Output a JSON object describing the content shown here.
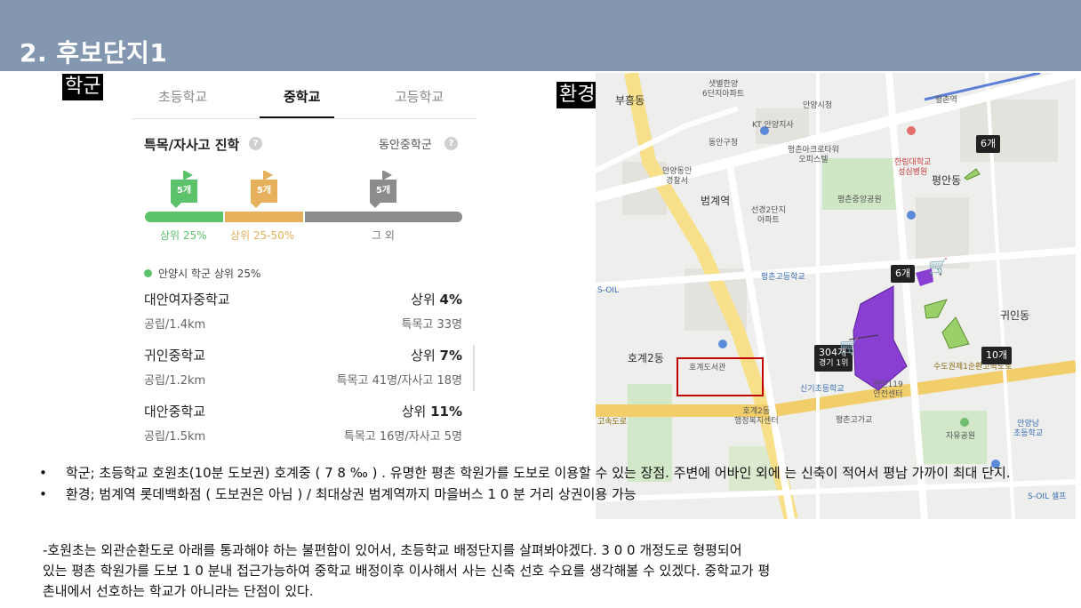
{
  "header": {
    "title": "2. 후보단지1"
  },
  "tags": {
    "school": "학군",
    "environment": "환경"
  },
  "school_panel": {
    "tabs": [
      {
        "label": "초등학교",
        "active": false
      },
      {
        "label": "중학교",
        "active": true
      },
      {
        "label": "고등학교",
        "active": false
      }
    ],
    "section_title": "특목/자사고 진학",
    "district": "동안중학군",
    "tiers": [
      {
        "count": "5개",
        "label": "상위 25%",
        "color": "#5cc26b",
        "share": 0.33
      },
      {
        "count": "5개",
        "label": "상위 25-50%",
        "color": "#e6b05c",
        "share": 0.25
      },
      {
        "count": "5개",
        "label": "그 외",
        "color": "#8c8c8c",
        "share": 0.42
      }
    ],
    "legend": "안양시 학군 상위 25%",
    "schools": [
      {
        "name": "대안여자중학교",
        "rank_prefix": "상위 ",
        "rank_value": "4%",
        "meta": "공립/1.4km",
        "extra": "특목고 33명"
      },
      {
        "name": "귀인중학교",
        "rank_prefix": "상위 ",
        "rank_value": "7%",
        "meta": "공립/1.2km",
        "extra": "특목고 41명/자사고 18명"
      },
      {
        "name": "대안중학교",
        "rank_prefix": "상위 ",
        "rank_value": "11%",
        "meta": "공립/1.5km",
        "extra": "특목고 16명/자사고 5명"
      }
    ]
  },
  "map": {
    "labels": {
      "buheung": "부흥동",
      "saetbyeol": "샛별한양\n6단지아파트",
      "anyang_city": "안양시청",
      "pyeongchon_station": "평촌역",
      "kt": "KT 안양지사",
      "dongan_gu": "동안구청",
      "pyeongchon_office": "평촌아크로타워\n오피스텔",
      "hallym": "한림대학교\n성심병원",
      "police": "안양동안\n경찰서",
      "beomgye": "범계역",
      "seongyeong": "선경2단지\n아파트",
      "pyeongchon_park": "평촌중앙공원",
      "pyeongan": "평안동",
      "pyeongchon_high": "평촌고등학교",
      "hogye2": "호계2동",
      "hogye_library": "호계도서관",
      "hogye_center": "호계2동\n행정복지센터",
      "singi": "신기초등학교",
      "gwiin119": "귀인119\n안전센터",
      "pyeongchon_overpass": "평촌고가교",
      "jayu": "자유공원",
      "soil": "S-OIL",
      "soil2": "S-OIL 셀프",
      "anyang_elem": "안양남\n초등학교",
      "gwiin": "귀인동",
      "expressway": "수도권제1순환고속도로",
      "highway_left": "고속도로"
    },
    "badges": {
      "top_right": "6개",
      "middle": "6개",
      "right": "10개",
      "main": "304개",
      "main_sub": "경기 1위"
    }
  },
  "bullets": [
    "학군; 초등학교 호원초(10분 도보권) 호계중 ( 7 8 ‰ ) . 유명한 평촌 학원가를 도보로 이용할 수 있는 장점.  주변에 어바인 외에 는 신축이 적어서 평남 가까이 최대 단지.",
    "환경; 범계역 롯데백화점 ( 도보권은 아님 )  / 최대상권 범계역까지 마을버스  1 0 분 거리 상권이용 가능"
  ],
  "note": "-호원초는 외관순환도로 아래를 통과해야 하는 불편함이 있어서,  초등학교 배정단지를 살펴봐야겠다.  3 0 0 개정도로 형평되어\n있는 평촌 학원가를 도보 1 0 분내 접근가능하여 중학교 배정이후 이사해서 사는 신축 선호 수요를 생각해볼 수 있겠다.  중학교가 평\n촌내에서 선호하는 학교가 아니라는 단점이 있다.",
  "icons": {
    "help": "?",
    "cart": "🛒",
    "bullet": "•"
  }
}
